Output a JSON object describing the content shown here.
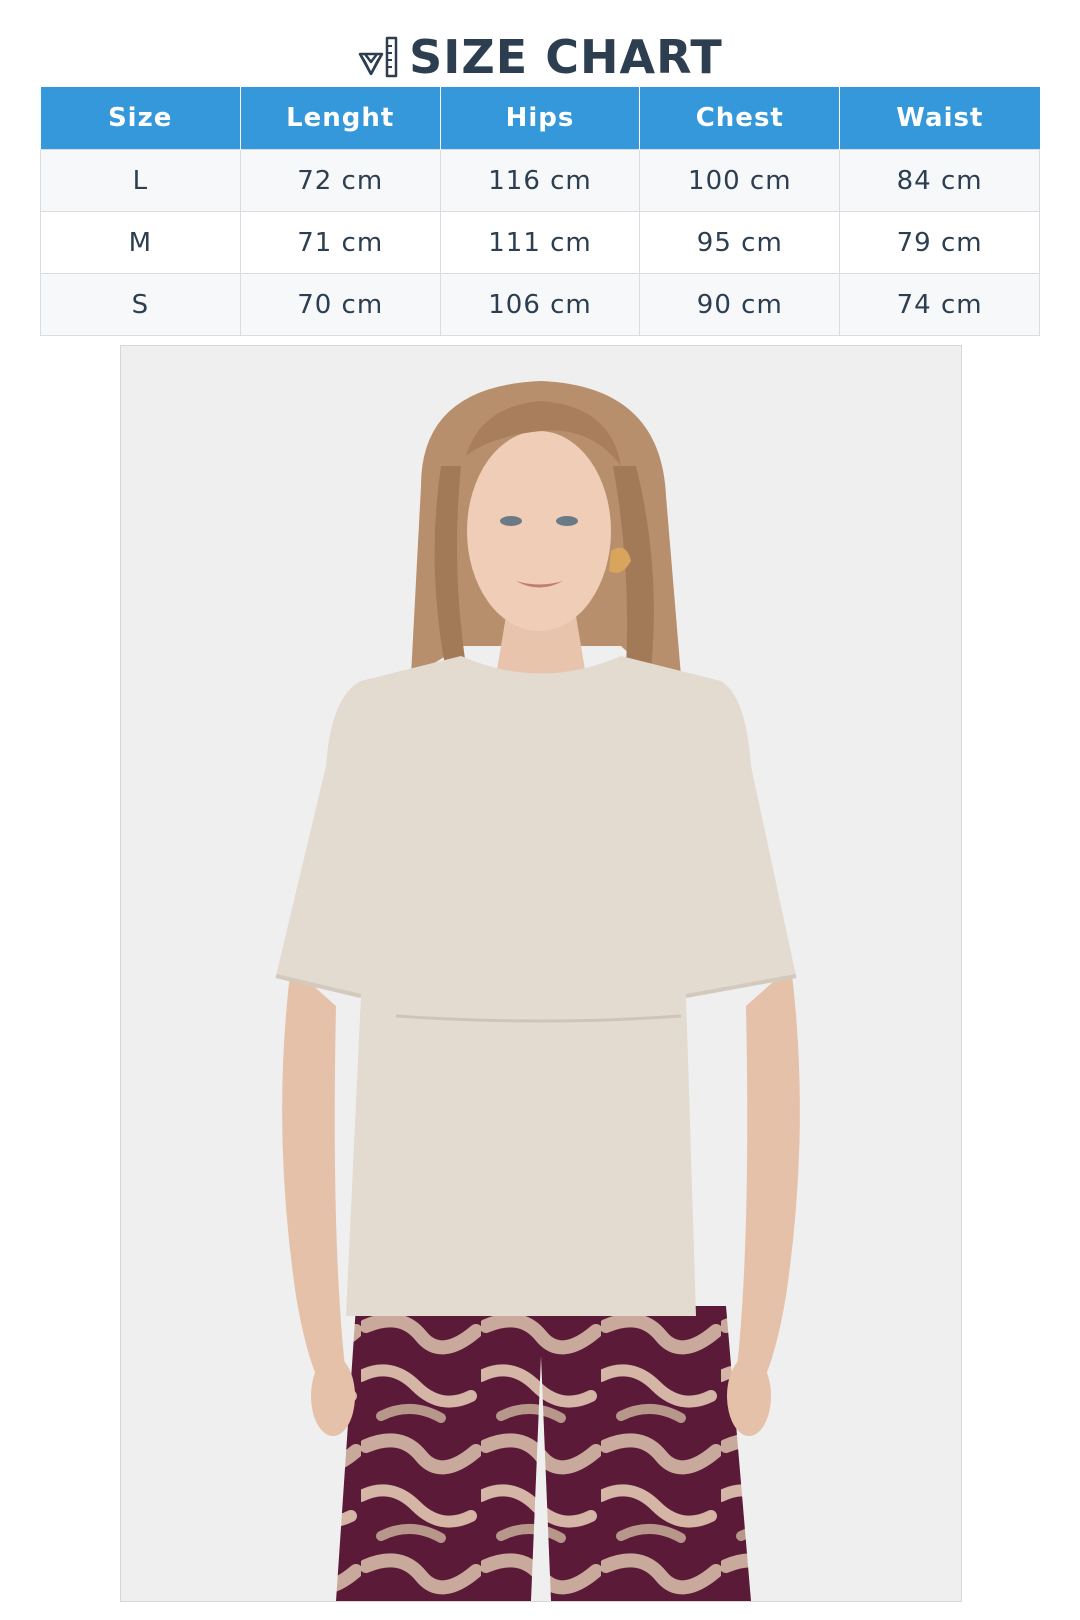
{
  "header": {
    "icon": "ruler-diamond-icon",
    "title": "SIZE CHART"
  },
  "table": {
    "columns": [
      "Size",
      "Lenght",
      "Hips",
      "Chest",
      "Waist"
    ],
    "rows": [
      [
        "L",
        "72 cm",
        "116 cm",
        "100 cm",
        "84 cm"
      ],
      [
        "M",
        "71 cm",
        "111 cm",
        "95 cm",
        "79 cm"
      ],
      [
        "S",
        "70 cm",
        "106 cm",
        "90 cm",
        "74 cm"
      ]
    ]
  },
  "colors": {
    "header_bg": "#3498db",
    "title_text": "#2c3e50",
    "row_alt": "#f6f8fa"
  },
  "photo": {
    "subject": "model-photo"
  }
}
